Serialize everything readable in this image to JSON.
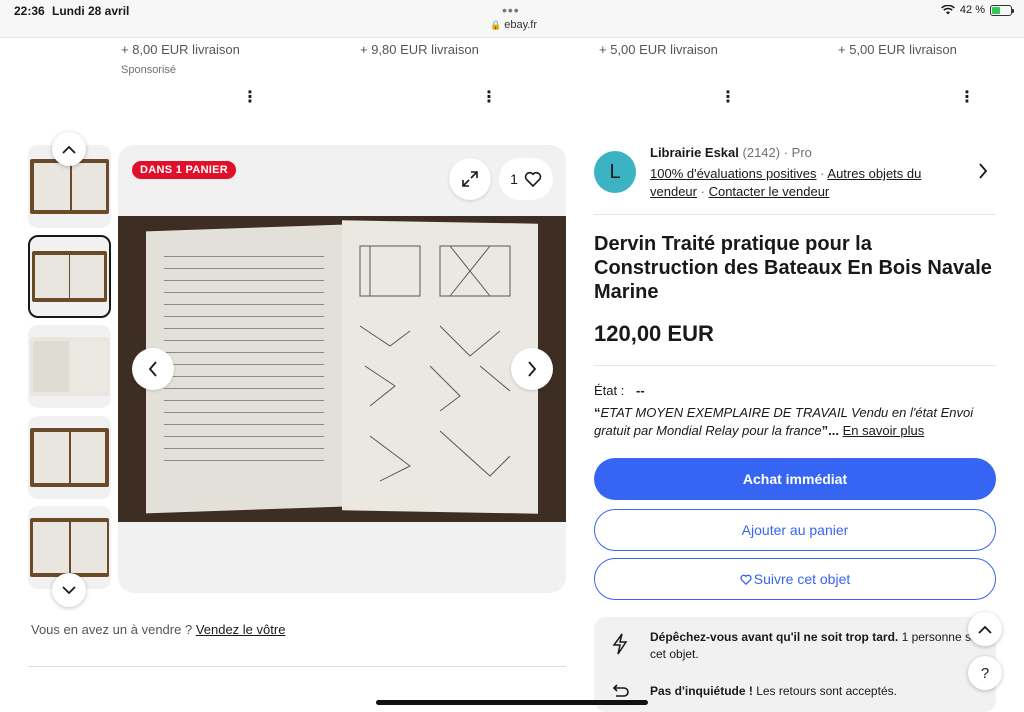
{
  "status_bar": {
    "time": "22:36",
    "date": "Lundi 28 avril",
    "dots": "•••",
    "url": "ebay.fr",
    "battery": "42 %"
  },
  "carousel_strip": {
    "shipping": [
      "+ 8,00 EUR livraison",
      "+ 9,80 EUR livraison",
      "+ 5,00 EUR livraison",
      "+ 5,00 EUR livraison"
    ],
    "sponsored": "Sponsorisé"
  },
  "gallery": {
    "badge": "DANS 1 PANIER",
    "watch_count": "1"
  },
  "sell_prompt": {
    "text": "Vous en avez un à vendre ?",
    "link": "Vendez le vôtre"
  },
  "seller": {
    "avatar_letter": "L",
    "name": "Librairie Eskal",
    "feedback_count": "(2142)",
    "type": "· Pro",
    "positive": "100% d'évaluations positives",
    "other_items": "Autres objets du vendeur",
    "contact": "Contacter le vendeur"
  },
  "item": {
    "title": "Dervin Traité pratique pour la Construction des Bateaux En Bois Navale Marine",
    "price": "120,00 EUR",
    "condition_label": "État :",
    "condition_value": "--",
    "description": "ETAT MOYEN EXEMPLAIRE DE TRAVAIL Vendu en l'état Envoi gratuit par Mondial Relay pour la france",
    "quote_open": "“",
    "quote_close": "”...",
    "more_link": "En savoir plus"
  },
  "actions": {
    "buy_now": "Achat immédiat",
    "add_to_cart": "Ajouter au panier",
    "watch": "Suivre cet objet"
  },
  "urgency": {
    "hurry_bold": "Dépêchez-vous avant qu'il ne soit trop tard.",
    "hurry_text": " 1 personne suit cet objet.",
    "returns_bold": "Pas d'inquiétude !",
    "returns_text": " Les retours sont acceptés."
  },
  "icons": {
    "help": "?"
  },
  "colors": {
    "brand_blue": "#3665f3",
    "badge_red": "#e0102b",
    "avatar_teal": "#3bb3c3"
  }
}
